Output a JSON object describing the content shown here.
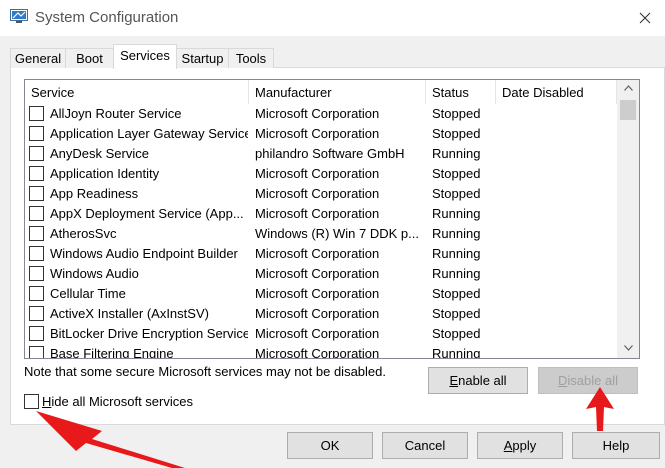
{
  "window": {
    "title": "System Configuration",
    "icon": "system-config-icon",
    "close_icon": "close-icon"
  },
  "tabs": [
    {
      "label": "General",
      "active": false
    },
    {
      "label": "Boot",
      "active": false
    },
    {
      "label": "Services",
      "active": true
    },
    {
      "label": "Startup",
      "active": false
    },
    {
      "label": "Tools",
      "active": false
    }
  ],
  "services": {
    "columns": [
      "Service",
      "Manufacturer",
      "Status",
      "Date Disabled"
    ],
    "rows": [
      {
        "name": "AllJoyn Router Service",
        "manufacturer": "Microsoft Corporation",
        "status": "Stopped",
        "date_disabled": ""
      },
      {
        "name": "Application Layer Gateway Service",
        "manufacturer": "Microsoft Corporation",
        "status": "Stopped",
        "date_disabled": ""
      },
      {
        "name": "AnyDesk Service",
        "manufacturer": "philandro Software GmbH",
        "status": "Running",
        "date_disabled": ""
      },
      {
        "name": "Application Identity",
        "manufacturer": "Microsoft Corporation",
        "status": "Stopped",
        "date_disabled": ""
      },
      {
        "name": "App Readiness",
        "manufacturer": "Microsoft Corporation",
        "status": "Stopped",
        "date_disabled": ""
      },
      {
        "name": "AppX Deployment Service (App...",
        "manufacturer": "Microsoft Corporation",
        "status": "Running",
        "date_disabled": ""
      },
      {
        "name": "AtherosSvc",
        "manufacturer": "Windows (R) Win 7 DDK p...",
        "status": "Running",
        "date_disabled": ""
      },
      {
        "name": "Windows Audio Endpoint Builder",
        "manufacturer": "Microsoft Corporation",
        "status": "Running",
        "date_disabled": ""
      },
      {
        "name": "Windows Audio",
        "manufacturer": "Microsoft Corporation",
        "status": "Running",
        "date_disabled": ""
      },
      {
        "name": "Cellular Time",
        "manufacturer": "Microsoft Corporation",
        "status": "Stopped",
        "date_disabled": ""
      },
      {
        "name": "ActiveX Installer (AxInstSV)",
        "manufacturer": "Microsoft Corporation",
        "status": "Stopped",
        "date_disabled": ""
      },
      {
        "name": "BitLocker Drive Encryption Service",
        "manufacturer": "Microsoft Corporation",
        "status": "Stopped",
        "date_disabled": ""
      },
      {
        "name": "Base Filtering Engine",
        "manufacturer": "Microsoft Corporation",
        "status": "Running",
        "date_disabled": ""
      }
    ],
    "scroll_up_icon": "chevron-up-icon",
    "scroll_down_icon": "chevron-down-icon"
  },
  "note": "Note that some secure Microsoft services may not be disabled.",
  "buttons": {
    "enable_all_accel": "E",
    "enable_all_rest": "nable all",
    "disable_all_accel": "D",
    "disable_all_rest": "isable all",
    "disable_all_enabled": false
  },
  "hide_ms": {
    "accel": "H",
    "rest": "ide all Microsoft services",
    "checked": false
  },
  "footer": {
    "ok": "OK",
    "cancel": "Cancel",
    "apply_accel": "A",
    "apply_rest": "pply",
    "help": "Help"
  },
  "annotations": {
    "arrow_color": "#e8191a"
  }
}
